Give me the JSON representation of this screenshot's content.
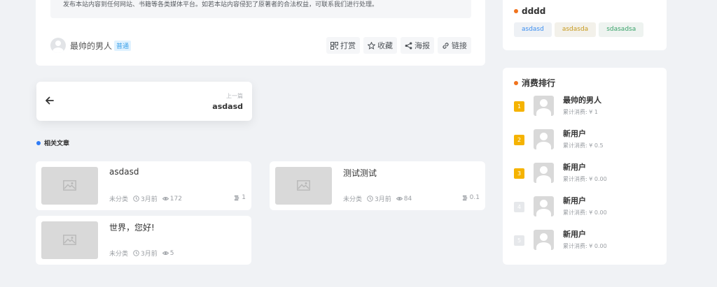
{
  "article": {
    "notice": "发布本站内容到任何网站、书籍等各类媒体平台。如若本站内容侵犯了原著者的合法权益，可联系我们进行处理。",
    "author_name": "最帅的男人",
    "author_badge": "普通",
    "actions": [
      {
        "label": "打赏",
        "icon": "qrcode-icon"
      },
      {
        "label": "收藏",
        "icon": "star-icon"
      },
      {
        "label": "海报",
        "icon": "share-icon"
      },
      {
        "label": "链接",
        "icon": "link-icon"
      }
    ]
  },
  "prev": {
    "label": "上一篇",
    "title": "asdasd"
  },
  "related": {
    "title": "相关文章",
    "posts": [
      {
        "title": "asdasd",
        "category": "未分类",
        "time": "3月前",
        "views": "172",
        "extra": "1"
      },
      {
        "title": "测试测试",
        "category": "未分类",
        "time": "3月前",
        "views": "84",
        "extra": "0.1"
      },
      {
        "title": "世界，您好!",
        "category": "未分类",
        "time": "3月前",
        "views": "5",
        "extra": ""
      }
    ]
  },
  "sidebar": {
    "tags_title": "dddd",
    "tags": [
      {
        "label": "asdasd",
        "color": "#3b8ef0",
        "bg": "#eef1f5"
      },
      {
        "label": "asdasda",
        "color": "#c79a1d",
        "bg": "#f3f1ea"
      },
      {
        "label": "sdasadsa",
        "color": "#39a36a",
        "bg": "#eef3f0"
      }
    ],
    "rank_title": "消费排行",
    "rank": [
      {
        "num": "1",
        "name": "最帅的男人",
        "sub": "累计消费: ¥ 1",
        "color": "#f5b301"
      },
      {
        "num": "2",
        "name": "新用户",
        "sub": "累计消费: ¥ 0.5",
        "color": "#f5b301"
      },
      {
        "num": "3",
        "name": "新用户",
        "sub": "累计消费: ¥ 0.00",
        "color": "#f5b301"
      },
      {
        "num": "4",
        "name": "新用户",
        "sub": "累计消费: ¥ 0.00",
        "color": "#e6e8eb"
      },
      {
        "num": "5",
        "name": "新用户",
        "sub": "累计消费: ¥ 0.00",
        "color": "#e6e8eb"
      }
    ]
  },
  "colors": {
    "accent_blue": "#2f7cf6",
    "accent_orange": "#f0731d"
  }
}
